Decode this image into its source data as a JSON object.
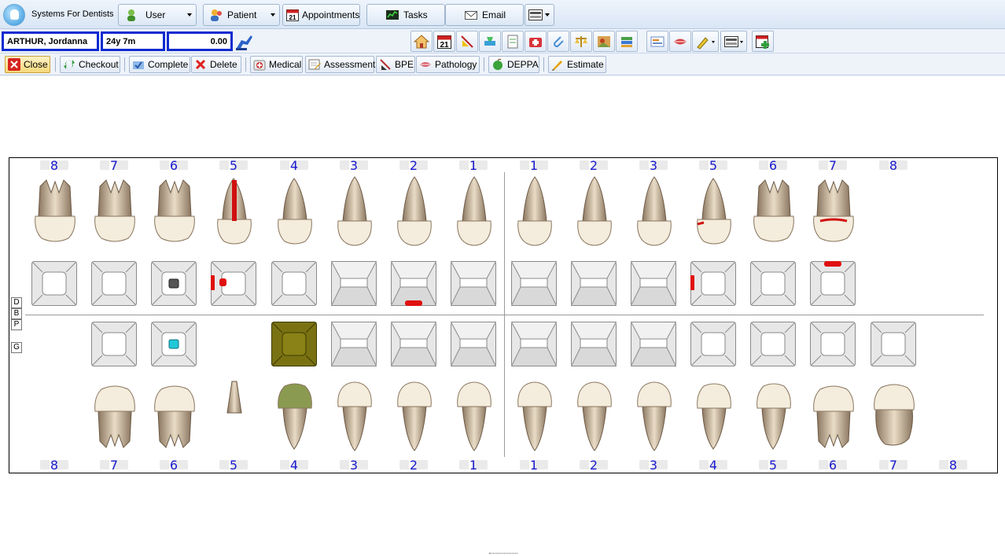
{
  "app": {
    "title": "Systems For Dentists"
  },
  "topbar": {
    "buttons": [
      {
        "label": "User",
        "has_dropdown": true
      },
      {
        "label": "Patient",
        "has_dropdown": true
      },
      {
        "label": "Appointments",
        "has_dropdown": false
      },
      {
        "label": "Tasks",
        "has_dropdown": false
      },
      {
        "label": "Email",
        "has_dropdown": false
      }
    ],
    "appointments_icon_day": "21"
  },
  "patient": {
    "name": "ARTHUR, Jordanna",
    "age": "24y 7m",
    "balance": "0.00"
  },
  "patient_toolbar_calendar_day": "21",
  "actions": [
    {
      "label": "Close",
      "icon": "close-icon",
      "color": "#d7261e"
    },
    {
      "label": "Checkout",
      "icon": "checkout-icon",
      "color": "#2d9b3a"
    },
    {
      "label": "Complete",
      "icon": "complete-icon",
      "color": "#3a78c8"
    },
    {
      "label": "Delete",
      "icon": "delete-icon",
      "color": "#e02020"
    },
    {
      "label": "Medical",
      "icon": "medical-icon",
      "color": "#c83030"
    },
    {
      "label": "Assessment",
      "icon": "assessment-icon",
      "color": "#d8a030"
    },
    {
      "label": "BPE",
      "icon": "bpe-icon",
      "color": "#b83030"
    },
    {
      "label": "Pathology",
      "icon": "pathology-icon",
      "color": "#d85a6a"
    },
    {
      "label": "DEPPA",
      "icon": "deppa-icon",
      "color": "#3aa33a"
    },
    {
      "label": "Estimate",
      "icon": "estimate-icon",
      "color": "#e6a000"
    }
  ],
  "chart": {
    "upper_numbers": [
      "8",
      "7",
      "6",
      "5",
      "4",
      "3",
      "2",
      "1",
      "1",
      "2",
      "3",
      "5",
      "6",
      "7",
      "8"
    ],
    "lower_numbers": [
      "8",
      "7",
      "6",
      "5",
      "4",
      "3",
      "2",
      "1",
      "1",
      "2",
      "3",
      "4",
      "5",
      "6",
      "7",
      "8"
    ],
    "side_labels": [
      "D",
      "B",
      "P",
      "G"
    ]
  }
}
